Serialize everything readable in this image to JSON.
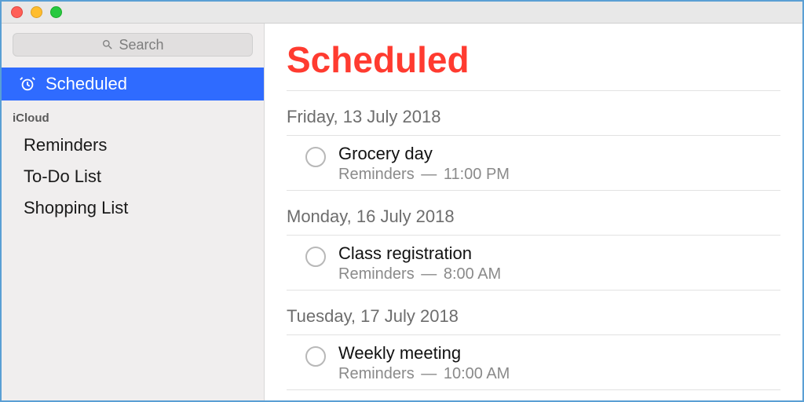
{
  "search": {
    "placeholder": "Search"
  },
  "sidebar": {
    "scheduled_label": "Scheduled",
    "section_label": "iCloud",
    "lists": [
      {
        "name": "Reminders"
      },
      {
        "name": "To-Do List"
      },
      {
        "name": "Shopping List"
      }
    ]
  },
  "main": {
    "title": "Scheduled",
    "groups": [
      {
        "date": "Friday, 13 July 2018",
        "items": [
          {
            "title": "Grocery day",
            "list": "Reminders",
            "time": "11:00 PM"
          }
        ]
      },
      {
        "date": "Monday, 16 July 2018",
        "items": [
          {
            "title": "Class registration",
            "list": "Reminders",
            "time": "8:00 AM"
          }
        ]
      },
      {
        "date": "Tuesday, 17 July 2018",
        "items": [
          {
            "title": "Weekly meeting",
            "list": "Reminders",
            "time": "10:00 AM"
          }
        ]
      }
    ]
  }
}
